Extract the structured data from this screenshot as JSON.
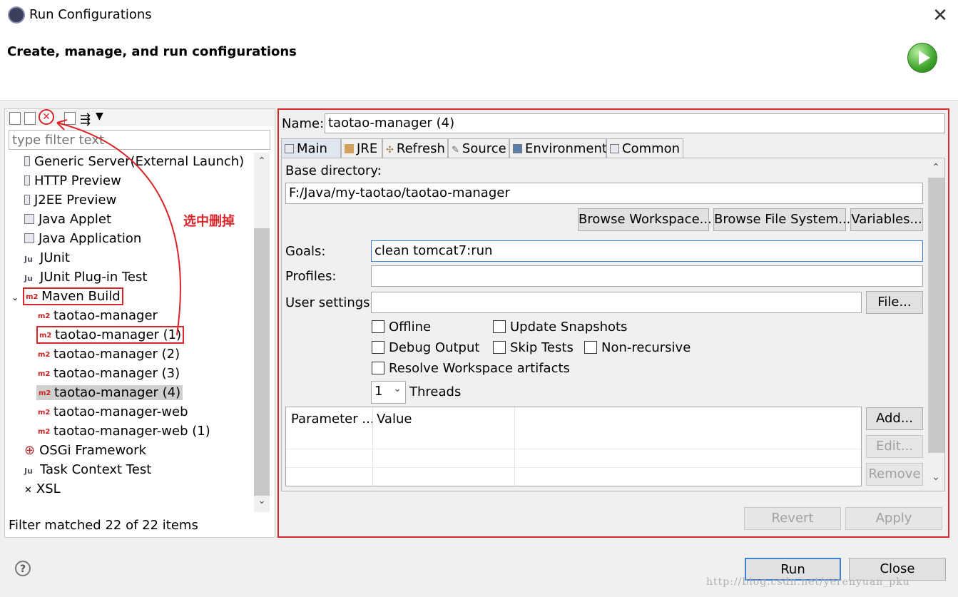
{
  "window": {
    "title": "Run Configurations",
    "header": "Create, manage, and run configurations"
  },
  "left": {
    "filter_placeholder": "type filter text",
    "tree": [
      {
        "label": "Generic Server(External Launch)",
        "icon": "server-icon"
      },
      {
        "label": "HTTP Preview",
        "icon": "server-icon"
      },
      {
        "label": "J2EE Preview",
        "icon": "server-icon"
      },
      {
        "label": "Java Applet",
        "icon": "applet-icon"
      },
      {
        "label": "Java Application",
        "icon": "java-app-icon"
      },
      {
        "label": "JUnit",
        "icon": "junit-icon"
      },
      {
        "label": "JUnit Plug-in Test",
        "icon": "junit-plugin-icon"
      },
      {
        "label": "Maven Build",
        "icon": "maven-icon",
        "expanded": true
      },
      {
        "label": "taotao-manager",
        "icon": "maven-icon"
      },
      {
        "label": "taotao-manager (1)",
        "icon": "maven-icon"
      },
      {
        "label": "taotao-manager (2)",
        "icon": "maven-icon"
      },
      {
        "label": "taotao-manager (3)",
        "icon": "maven-icon"
      },
      {
        "label": "taotao-manager (4)",
        "icon": "maven-icon",
        "selected": true
      },
      {
        "label": "taotao-manager-web",
        "icon": "maven-icon"
      },
      {
        "label": "taotao-manager-web (1)",
        "icon": "maven-icon"
      },
      {
        "label": "OSGi Framework",
        "icon": "osgi-icon"
      },
      {
        "label": "Task Context Test",
        "icon": "junit-icon"
      },
      {
        "label": "XSL",
        "icon": "xsl-icon"
      }
    ],
    "status": "Filter matched 22 of 22 items",
    "annotation": "选中删掉"
  },
  "right": {
    "name_label": "Name:",
    "name_value": "taotao-manager (4)",
    "tabs": [
      {
        "label": "Main",
        "icon": "main-tab-icon",
        "active": true
      },
      {
        "label": "JRE",
        "icon": "jre-icon"
      },
      {
        "label": "Refresh",
        "icon": "refresh-icon"
      },
      {
        "label": "Source",
        "icon": "source-icon"
      },
      {
        "label": "Environment",
        "icon": "environment-icon"
      },
      {
        "label": "Common",
        "icon": "common-icon"
      }
    ],
    "base_dir_label": "Base directory:",
    "base_dir_value": "F:/Java/my-taotao/taotao-manager",
    "browse_workspace": "Browse Workspace...",
    "browse_fs": "Browse File System...",
    "variables": "Variables...",
    "goals_label": "Goals:",
    "goals_value": "clean tomcat7:run",
    "profiles_label": "Profiles:",
    "profiles_value": "",
    "user_settings_label": "User settings:",
    "user_settings_value": "",
    "file_btn": "File...",
    "checkboxes": {
      "offline": "Offline",
      "update_snapshots": "Update Snapshots",
      "debug_output": "Debug Output",
      "skip_tests": "Skip Tests",
      "non_recursive": "Non-recursive",
      "resolve_workspace": "Resolve Workspace artifacts"
    },
    "threads_value": "1",
    "threads_label": "Threads",
    "param_col": "Parameter ...",
    "value_col": "Value",
    "add_btn": "Add...",
    "edit_btn": "Edit...",
    "remove_btn": "Remove",
    "revert_btn": "Revert",
    "apply_btn": "Apply"
  },
  "footer": {
    "run_btn": "Run",
    "close_btn": "Close",
    "help": "?",
    "watermark": "http://blog.csdn.net/yerenyuan_pku"
  }
}
